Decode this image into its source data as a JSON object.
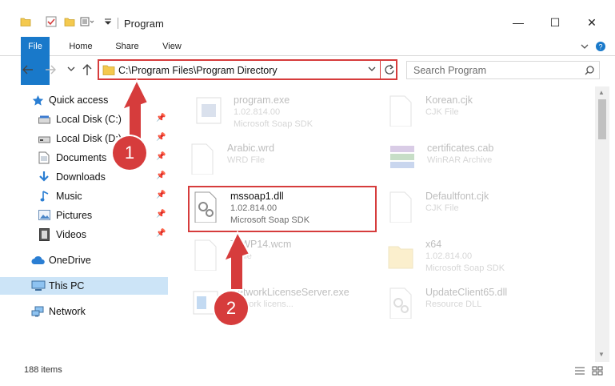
{
  "window": {
    "title": "Program",
    "minimize_symbol": "—",
    "maximize_symbol": "☐",
    "close_symbol": "✕"
  },
  "ribbon": {
    "tabs": [
      "File",
      "Home",
      "Share",
      "View"
    ]
  },
  "address": {
    "path": "C:\\Program Files\\Program Directory",
    "search_placeholder": "Search Program"
  },
  "nav": {
    "quick_access": "Quick access",
    "items": [
      {
        "label": "Local Disk (C:)",
        "icon": "drive-icon"
      },
      {
        "label": "Local Disk (D:)",
        "icon": "drive-icon"
      },
      {
        "label": "Documents",
        "icon": "documents-icon"
      },
      {
        "label": "Downloads",
        "icon": "downloads-icon"
      },
      {
        "label": "Music",
        "icon": "music-icon"
      },
      {
        "label": "Pictures",
        "icon": "pictures-icon"
      },
      {
        "label": "Videos",
        "icon": "videos-icon"
      }
    ],
    "onedrive": "OneDrive",
    "this_pc": "This PC",
    "network": "Network"
  },
  "files": [
    {
      "name": "program.exe",
      "line1": "1.02.814.00",
      "line2": "Microsoft Soap SDK"
    },
    {
      "name": "Korean.cjk",
      "line1": "CJK File",
      "line2": ""
    },
    {
      "name": "Arabic.wrd",
      "line1": "WRD File",
      "line2": ""
    },
    {
      "name": "certificates.cab",
      "line1": "WinRAR Archive",
      "line2": ""
    },
    {
      "name": "mssoap1.dll",
      "line1": "1.02.814.00",
      "line2": "Microsoft Soap SDK"
    },
    {
      "name": "Defaultfont.cjk",
      "line1": "CJK File",
      "line2": ""
    },
    {
      "name": "ToWP14.wcm",
      "line1": "d File",
      "line2": ""
    },
    {
      "name": "x64",
      "line1": "1.02.814.00",
      "line2": "Microsoft Soap SDK"
    },
    {
      "name": "NetworkLicenseServer.exe",
      "line1": "network licens...",
      "line2": ""
    },
    {
      "name": "UpdateClient65.dll",
      "line1": "Resource DLL",
      "line2": ""
    }
  ],
  "status": {
    "item_count": "188 items"
  },
  "annotations": [
    "1",
    "2"
  ],
  "colors": {
    "highlight": "#d63c3c",
    "file_tab": "#1979ca",
    "selected_nav": "#cce4f7"
  }
}
